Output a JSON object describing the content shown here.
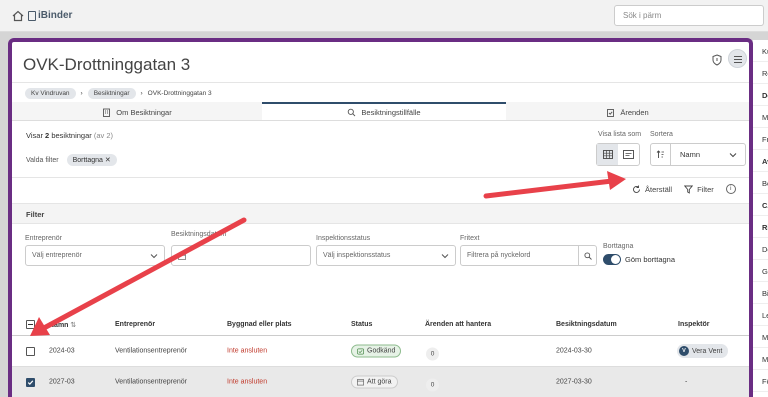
{
  "topbar": {
    "brand": "iBinder",
    "search_placeholder": "Sök i pärm"
  },
  "modal": {
    "title": "OVK-Drottninggatan 3",
    "breadcrumbs": [
      "Kv Vindruvan",
      "Besiktningar",
      "OVK-Drottninggatan 3"
    ],
    "tabs": [
      {
        "label": "Om Besiktningar",
        "icon": "building-icon"
      },
      {
        "label": "Besiktningstillfälle",
        "icon": "search-icon"
      },
      {
        "label": "Ärenden",
        "icon": "clipboard-check-icon"
      }
    ],
    "active_tab": 1
  },
  "summary": {
    "prefix": "Visar",
    "count": "2",
    "suffix": "besiktningar",
    "total": "(av 2)"
  },
  "selected_filters": {
    "label": "Valda filter",
    "chip": "Borttagna"
  },
  "view": {
    "label": "Visa lista som",
    "active": "grid"
  },
  "sort": {
    "label": "Sortera",
    "value": "Namn"
  },
  "actions": {
    "reset": "Återställ",
    "filter": "Filter",
    "info": "i"
  },
  "filter_panel": {
    "header": "Filter",
    "contractor": {
      "label": "Entreprenör",
      "placeholder": "Välj entreprenör"
    },
    "date": {
      "label": "Besiktningsdatum"
    },
    "status": {
      "label": "Inspektionsstatus",
      "placeholder": "Välj inspektionsstatus"
    },
    "freetext": {
      "label": "Fritext",
      "placeholder": "Filtrera på nyckelord"
    },
    "deleted": {
      "label": "Borttagna",
      "toggle_label": "Göm borttagna"
    }
  },
  "table": {
    "headers": [
      "Namn",
      "Entreprenör",
      "Byggnad eller plats",
      "Status",
      "Ärenden att hantera",
      "Besiktningsdatum",
      "Inspektör"
    ],
    "rows": [
      {
        "name": "2024-03",
        "contractor": "Ventilationsentreprenör",
        "building": "Inte ansluten",
        "status": "Godkänd",
        "status_type": "ok",
        "issues": "0",
        "date": "2024-03-30",
        "inspector": "Vera Vent",
        "inspector_initial": "V",
        "checked": false
      },
      {
        "name": "2027-03",
        "contractor": "Ventilationsentreprenör",
        "building": "Inte ansluten",
        "status": "Att göra",
        "status_type": "todo",
        "issues": "0",
        "date": "2027-03-30",
        "inspector": "-",
        "inspector_initial": "",
        "checked": true
      }
    ]
  },
  "right_panel": [
    "Ku",
    "Re",
    "De",
    "M",
    "Fr",
    "Av",
    "Be",
    "CA",
    "Ri",
    "De",
    "Ga",
    "Bi",
    "Le",
    "M",
    "M",
    "Fö"
  ],
  "colors": {
    "accent": "#6a2d83",
    "primary": "#2f4d6b",
    "arrow": "#e8414a",
    "danger": "#c0392b"
  }
}
